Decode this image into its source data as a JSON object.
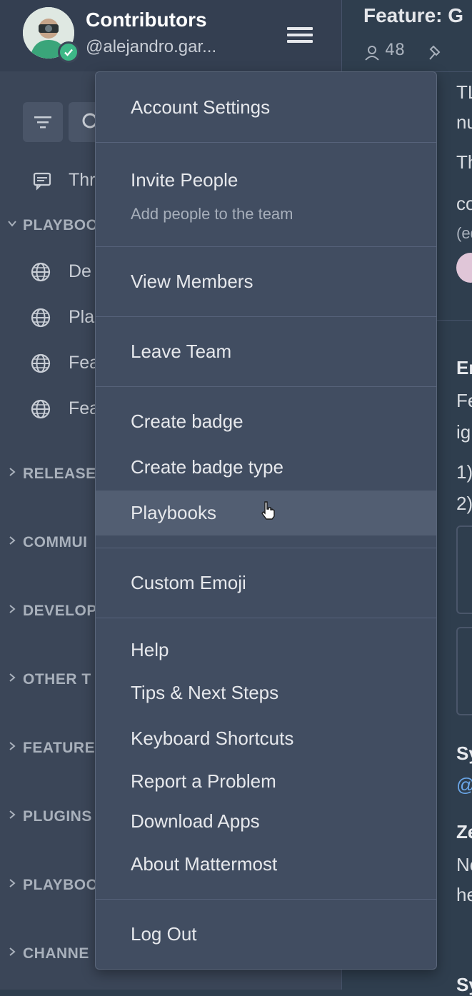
{
  "team": {
    "name": "Contributors",
    "username": "@alejandro.gar..."
  },
  "sidebar": {
    "threads_label": "Thr",
    "categories": [
      {
        "label": "PLAYBOO",
        "expanded": true
      },
      {
        "label": "RELEASES",
        "expanded": false
      },
      {
        "label": "COMMUI",
        "expanded": false
      },
      {
        "label": "DEVELOP",
        "expanded": false
      },
      {
        "label": "OTHER T",
        "expanded": false
      },
      {
        "label": "FEATURE",
        "expanded": false
      },
      {
        "label": "PLUGINS",
        "expanded": false
      },
      {
        "label": "PLAYBOO",
        "expanded": false
      },
      {
        "label": "CHANNE",
        "expanded": false
      }
    ],
    "channels": [
      {
        "label": "De"
      },
      {
        "label": "Pla"
      },
      {
        "label": "Fea"
      },
      {
        "label": "Fea"
      }
    ]
  },
  "channel": {
    "title": "Feature: G",
    "member_count": "48",
    "snippets": [
      "TL",
      "nu",
      "Th",
      "co",
      "(ed",
      "Er",
      "Fe",
      "ig",
      "1)",
      "2)",
      "Sy",
      "@",
      "Ze",
      "No",
      "he",
      "Sy"
    ]
  },
  "menu": {
    "account_settings": "Account Settings",
    "invite_people": "Invite People",
    "invite_people_sub": "Add people to the team",
    "view_members": "View Members",
    "leave_team": "Leave Team",
    "create_badge": "Create badge",
    "create_badge_type": "Create badge type",
    "playbooks": "Playbooks",
    "custom_emoji": "Custom Emoji",
    "help": "Help",
    "tips": "Tips & Next Steps",
    "keyboard_shortcuts": "Keyboard Shortcuts",
    "report_problem": "Report a Problem",
    "download_apps": "Download Apps",
    "about": "About Mattermost",
    "log_out": "Log Out"
  },
  "colors": {
    "sidebar_bg": "#3b4658",
    "menu_bg": "#414d61",
    "menu_hover": "#525e72",
    "online_status": "#3db887",
    "link": "#6aa6e8"
  },
  "icons": [
    "filter-icon",
    "search-icon",
    "threads-icon",
    "globe-icon",
    "chevron-right-icon",
    "chevron-down-icon",
    "hamburger-menu-icon",
    "member-icon",
    "pin-icon",
    "pointer-cursor-icon"
  ]
}
